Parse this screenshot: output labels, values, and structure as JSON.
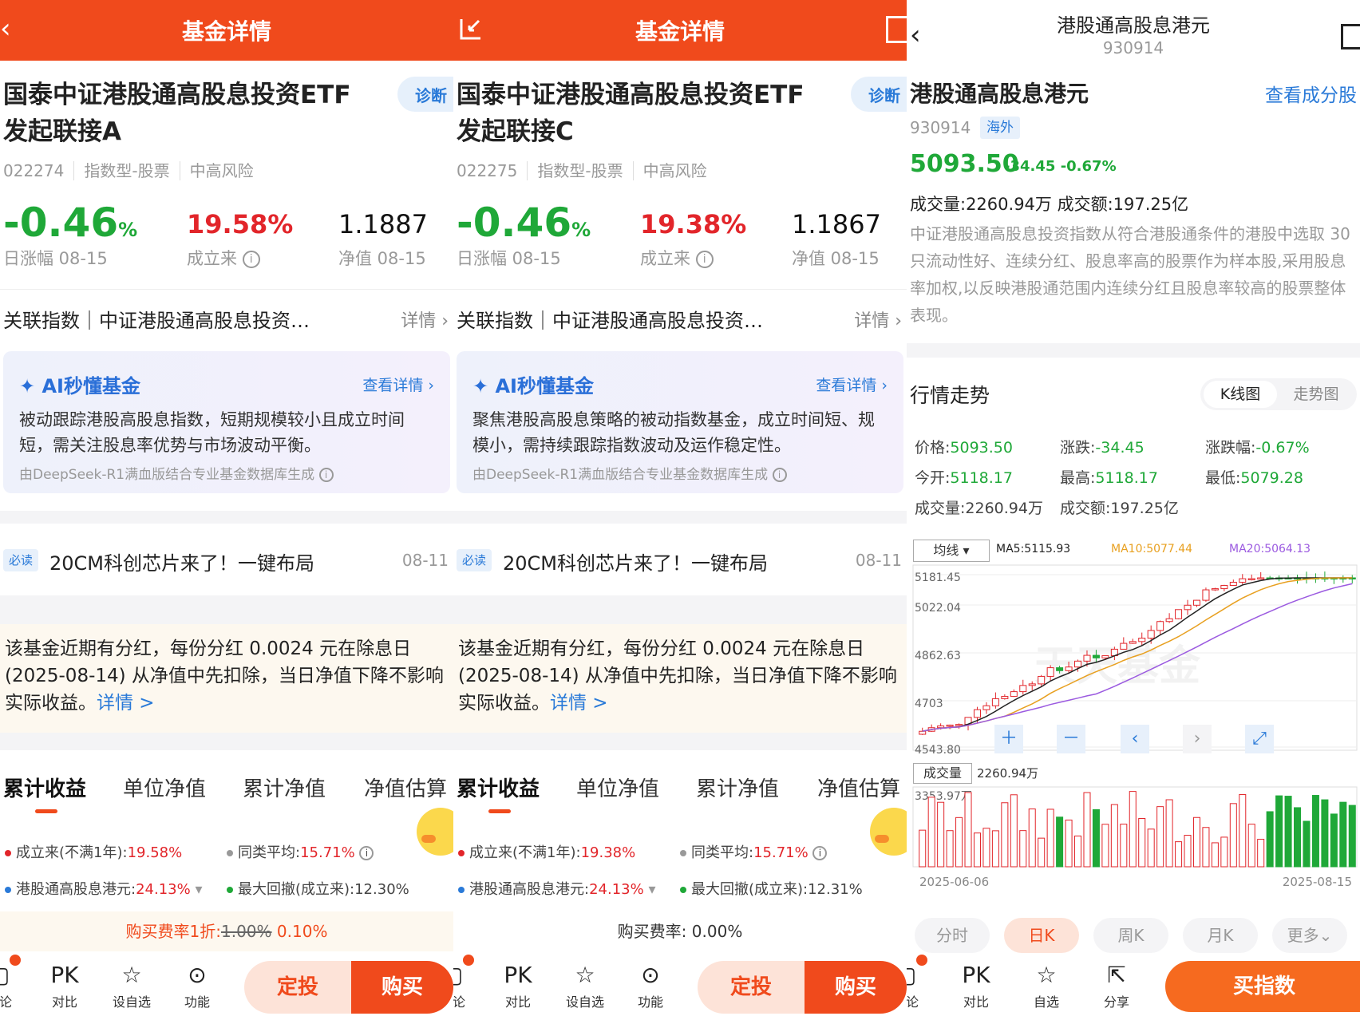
{
  "fund_header": {
    "title": "基金详情"
  },
  "funds": [
    {
      "name_line1": "国泰中证港股通高股息投资ETF",
      "name_line2": "发起联接A",
      "diag": "诊断",
      "code": "022274",
      "type": "指数型-股票",
      "risk": "中高风险",
      "day_change_num": "-0.46",
      "day_change_unit": "%",
      "day_change_label": "日涨幅 08-15",
      "since_inception": "19.58%",
      "since_label": "成立来",
      "nav": "1.1887",
      "nav_label": "净值 08-15",
      "related_index": "关联指数｜中证港股通高股息投资…",
      "related_more": "详情 ›",
      "ai_title": "AI秒懂基金",
      "ai_more": "查看详情 ›",
      "ai_text": "被动跟踪港股高股息指数，短期规模较小且成立时间短，需关注股息率优势与市场波动平衡。",
      "ai_source": "由DeepSeek-R1满血版结合专业基金数据库生成",
      "news_tag": "必读",
      "news_title": "20CM科创芯片来了！一键布局",
      "news_date": "08-11",
      "dividend_text": "该基金近期有分红，每份分红 0.0024 元在除息日 (2025-08-14) 从净值中先扣除，当日净值下降不影响实际收益。",
      "dividend_link": "详情 >",
      "tabs": [
        "累计收益",
        "单位净值",
        "累计净值",
        "净值估算"
      ],
      "stat_since_label": "成立来(不满1年):",
      "stat_since_val": "19.58%",
      "stat_avg_label": "同类平均:",
      "stat_avg_val": "15.71%",
      "stat_idx_label": "港股通高股息港元:",
      "stat_idx_val": "24.13%",
      "stat_dd_label": "最大回撤(成立来):",
      "stat_dd_val": "12.30%",
      "fee_label": "购买费率1折:",
      "fee_old": "1.00%",
      "fee_new": "0.10%",
      "bar_discuss": "讨论",
      "bar_pk": "对比",
      "bar_fav": "设自选",
      "bar_func": "功能",
      "btn_dingtou": "定投",
      "btn_buy": "购买"
    },
    {
      "name_line1": "国泰中证港股通高股息投资ETF",
      "name_line2": "发起联接C",
      "diag": "诊断",
      "code": "022275",
      "type": "指数型-股票",
      "risk": "中高风险",
      "day_change_num": "-0.46",
      "day_change_unit": "%",
      "day_change_label": "日涨幅 08-15",
      "since_inception": "19.38%",
      "since_label": "成立来",
      "nav": "1.1867",
      "nav_label": "净值 08-15",
      "related_index": "关联指数｜中证港股通高股息投资…",
      "related_more": "详情 ›",
      "ai_title": "AI秒懂基金",
      "ai_more": "查看详情 ›",
      "ai_text": "聚焦港股高股息策略的被动指数基金，成立时间短、规模小，需持续跟踪指数波动及运作稳定性。",
      "ai_source": "由DeepSeek-R1满血版结合专业基金数据库生成",
      "news_tag": "必读",
      "news_title": "20CM科创芯片来了！一键布局",
      "news_date": "08-11",
      "dividend_text": "该基金近期有分红，每份分红 0.0024 元在除息日 (2025-08-14) 从净值中先扣除，当日净值下降不影响实际收益。",
      "dividend_link": "详情 >",
      "tabs": [
        "累计收益",
        "单位净值",
        "累计净值",
        "净值估算"
      ],
      "stat_since_label": "成立来(不满1年):",
      "stat_since_val": "19.38%",
      "stat_avg_label": "同类平均:",
      "stat_avg_val": "15.71%",
      "stat_idx_label": "港股通高股息港元:",
      "stat_idx_val": "24.13%",
      "stat_dd_label": "最大回撤(成立来):",
      "stat_dd_val": "12.31%",
      "fee_label": "购买费率:",
      "fee_new": "0.00%",
      "bar_discuss": "讨论",
      "bar_pk": "对比",
      "bar_fav": "设自选",
      "bar_func": "功能",
      "btn_dingtou": "定投",
      "btn_buy": "购买"
    }
  ],
  "index_page": {
    "header_title": "港股通高股息港元",
    "header_code": "930914",
    "name": "港股通高股息港元",
    "view_components": "查看成分股",
    "code": "930914",
    "tag": "海外",
    "price": "5093.50",
    "change": "-34.45",
    "change_pct": "-0.67%",
    "volume_line": "成交量:2260.94万   成交额:197.25亿",
    "description": "中证港股通高股息投资指数从符合港股通条件的港股中选取 30 只流动性好、连续分红、股息率高的股票作为样本股,采用股息率加权,以反映港股通范围内连续分红且股息率较高的股票整体表现。",
    "trend_title": "行情走势",
    "kline_tab": "K线图",
    "trend_tab": "走势图",
    "quote": {
      "price_label": "价格:",
      "price": "5093.50",
      "chg_label": "涨跌:",
      "chg": "-34.45",
      "pct_label": "涨跌幅:",
      "pct": "-0.67%",
      "open_label": "今开:",
      "open": "5118.17",
      "high_label": "最高:",
      "high": "5118.17",
      "low_label": "最低:",
      "low": "5079.28",
      "vol_label": "成交量:",
      "vol": "2260.94万",
      "amt_label": "成交额:",
      "amt": "197.25亿"
    },
    "ma_select": "均线",
    "ma5": "MA5:5115.93",
    "ma10": "MA10:5077.44",
    "ma20": "MA20:5064.13",
    "ma_colors": {
      "ma5": "#222222",
      "ma10": "#e8a020",
      "ma20": "#9b5ae0"
    },
    "y_ticks": [
      "5181.45",
      "5022.04",
      "4862.63",
      "4703",
      "4543.80"
    ],
    "watermark": "天天基金",
    "vol_btn": "成交量",
    "vol_val": "2260.94万",
    "vol_max": "3353.97万",
    "date_start": "2025-06-06",
    "date_end": "2025-08-15",
    "periods": [
      "分时",
      "日K",
      "周K",
      "月K",
      "更多⌄"
    ],
    "bar_discuss": "讨论",
    "bar_pk": "对比",
    "bar_fav": "自选",
    "bar_share": "分享",
    "buy_index": "买指数"
  }
}
